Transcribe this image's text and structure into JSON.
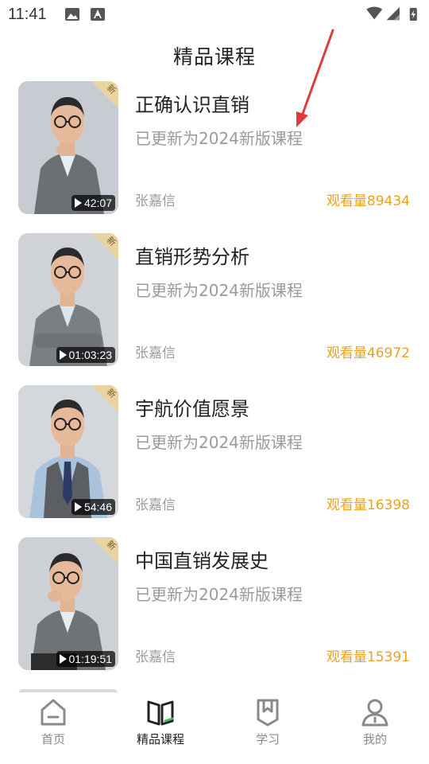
{
  "status_bar": {
    "time": "11:41"
  },
  "page": {
    "title": "精品课程"
  },
  "courses": [
    {
      "title": "正确认识直销",
      "subtitle": "已更新为2024新版课程",
      "author": "张嘉信",
      "views": "观看量89434",
      "duration": "42:07",
      "badge": "新"
    },
    {
      "title": "直销形势分析",
      "subtitle": "已更新为2024新版课程",
      "author": "张嘉信",
      "views": "观看量46972",
      "duration": "01:03:23",
      "badge": "新"
    },
    {
      "title": "宇航价值愿景",
      "subtitle": "已更新为2024新版课程",
      "author": "张嘉信",
      "views": "观看量16398",
      "duration": "54:46",
      "badge": "新"
    },
    {
      "title": "中国直销发展史",
      "subtitle": "已更新为2024新版课程",
      "author": "张嘉信",
      "views": "观看量15391",
      "duration": "01:19:51",
      "badge": "新"
    }
  ],
  "nav": {
    "items": [
      {
        "label": "首页",
        "icon": "home-icon"
      },
      {
        "label": "精品课程",
        "icon": "book-icon",
        "active": true
      },
      {
        "label": "学习",
        "icon": "bookmark-icon"
      },
      {
        "label": "我的",
        "icon": "user-icon"
      }
    ]
  },
  "colors": {
    "accent": "#e8a21e",
    "arrow": "#e03c3c",
    "nav_active_green": "#3dbb5e"
  }
}
